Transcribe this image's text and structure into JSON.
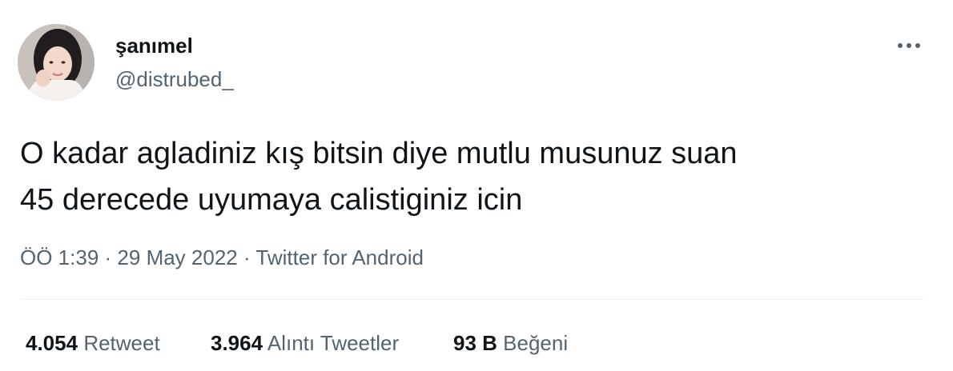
{
  "author": {
    "display_name": "şanımel",
    "handle": "@distrubed_"
  },
  "tweet": {
    "text_lines": [
      "O kadar agladiniz kış bitsin diye mutlu musunuz suan",
      "45 derecede uyumaya calistiginiz icin"
    ]
  },
  "meta": {
    "time": "ÖÖ 1:39",
    "separator": "·",
    "date": "29 May 2022",
    "source": "Twitter for Android"
  },
  "stats": {
    "retweets": {
      "count": "4.054",
      "label": "Retweet"
    },
    "quotes": {
      "count": "3.964",
      "label": "Alıntı Tweetler"
    },
    "likes": {
      "count": "93 B",
      "label": "Beğeni"
    }
  },
  "icons": {
    "more": "more-horizontal-icon"
  },
  "colors": {
    "primary_text": "#0f1419",
    "secondary_text": "#536471",
    "divider": "#eff3f4"
  }
}
